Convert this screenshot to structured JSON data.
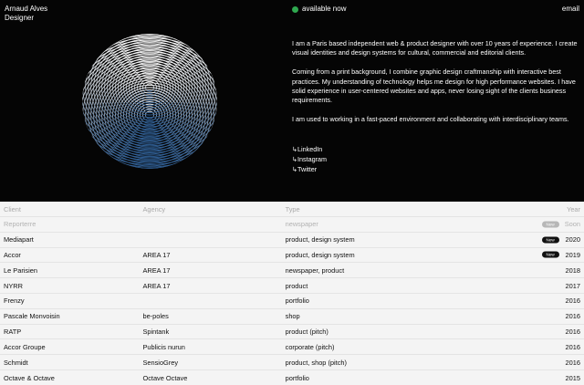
{
  "header": {
    "name": "Arnaud Alves",
    "role": "Designer",
    "status": "available now",
    "email": "email",
    "status_color": "#2fa84f"
  },
  "bio": {
    "p1": "I am a Paris based independent web & product designer with over 10 years of experience. I create visual identities and design systems for cultural, commercial and editorial clients.",
    "p2": "Coming from a print background, I combine graphic design craftmanship with interactive best practices. My understanding of technology helps me design for high performance websites. I have solid experience in user-centered websites and apps, never losing sight of the clients business requirements.",
    "p3": "I am used to working in a fast-paced environment and collaborating with interdisciplinary teams."
  },
  "links": [
    "↳LinkedIn",
    "↳Instagram",
    "↳Twitter"
  ],
  "table": {
    "headers": [
      "Client",
      "Agency",
      "Type",
      "Year"
    ],
    "rows": [
      {
        "client": "Reporterre",
        "agency": "",
        "type": "newspaper",
        "badge": "New",
        "badge_style": "grey",
        "year": "Soon",
        "muted": true
      },
      {
        "client": "Mediapart",
        "agency": "",
        "type": "product, design system",
        "badge": "New",
        "badge_style": "dark",
        "year": "2020"
      },
      {
        "client": "Accor",
        "agency": "AREA 17",
        "type": "product, design system",
        "badge": "New",
        "badge_style": "dark",
        "year": "2019"
      },
      {
        "client": "Le Parisien",
        "agency": "AREA 17",
        "type": "newspaper, product",
        "year": "2018"
      },
      {
        "client": "NYRR",
        "agency": "AREA 17",
        "type": "product",
        "year": "2017"
      },
      {
        "client": "Frenzy",
        "agency": "",
        "type": "portfolio",
        "year": "2016"
      },
      {
        "client": "Pascale Monvoisin",
        "agency": "be-poles",
        "type": "shop",
        "year": "2016"
      },
      {
        "client": "RATP",
        "agency": "Spintank",
        "type": "product (pitch)",
        "year": "2016"
      },
      {
        "client": "Accor Groupe",
        "agency": "Publicis nurun",
        "type": "corporate (pitch)",
        "year": "2016"
      },
      {
        "client": "Schmidt",
        "agency": "SensioGrey",
        "type": "product, shop (pitch)",
        "year": "2016"
      },
      {
        "client": "Octave & Octave",
        "agency": "Octave Octave",
        "type": "portfolio",
        "year": "2015"
      }
    ]
  }
}
